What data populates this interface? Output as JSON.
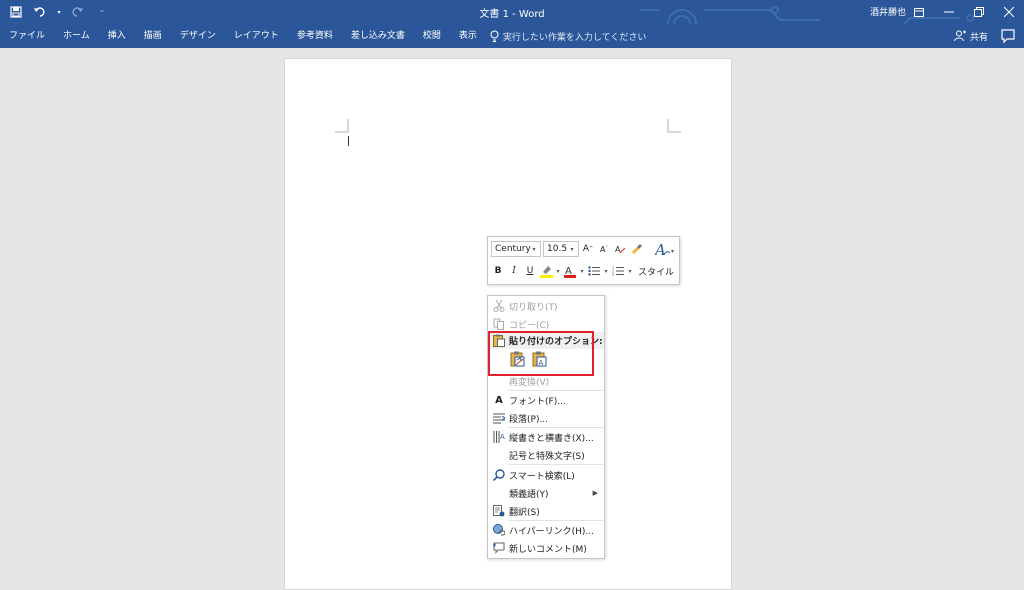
{
  "titlebar": {
    "title": "文書 1 - Word",
    "user": "酒井勝也",
    "accent": "#2b579a"
  },
  "qat": [
    "save-icon",
    "undo-icon",
    "redo-icon",
    "customize-icon"
  ],
  "ribbon": {
    "tabs": [
      "ファイル",
      "ホーム",
      "挿入",
      "描画",
      "デザイン",
      "レイアウト",
      "参考資料",
      "差し込み文書",
      "校閲",
      "表示"
    ],
    "tell_me": "実行したい作業を入力してください",
    "share": "共有"
  },
  "mini_toolbar": {
    "font": "Century",
    "size": "10.5",
    "bold": "B",
    "italic": "I",
    "underline": "U",
    "styles": "スタイル",
    "highlight_color": "#ffee00",
    "font_color": "#e02020"
  },
  "context_menu": {
    "items": [
      {
        "label": "切り取り(T)",
        "icon": "scissors-icon",
        "disabled": true
      },
      {
        "label": "コピー(C)",
        "icon": "copy-icon",
        "disabled": true
      },
      {
        "label": "貼り付けのオプション:",
        "icon": "paste-icon",
        "header": true
      },
      {
        "label": "再変換(V)",
        "icon": "",
        "disabled": true
      },
      {
        "label": "フォント(F)...",
        "icon": "font-icon"
      },
      {
        "label": "段落(P)...",
        "icon": "paragraph-icon"
      },
      {
        "label": "縦書きと横書き(X)...",
        "icon": "text-direction-icon"
      },
      {
        "label": "記号と特殊文字(S)",
        "icon": ""
      },
      {
        "label": "スマート検索(L)",
        "icon": "smart-lookup-icon"
      },
      {
        "label": "類義語(Y)",
        "icon": "",
        "submenu": true
      },
      {
        "label": "翻訳(S)",
        "icon": "translate-icon"
      },
      {
        "label": "ハイパーリンク(H)...",
        "icon": "hyperlink-icon"
      },
      {
        "label": "新しいコメント(M)",
        "icon": "new-comment-icon"
      }
    ],
    "paste_options": [
      "keep-source-formatting-icon",
      "keep-text-only-icon"
    ],
    "highlight_color": "#e0202a"
  }
}
